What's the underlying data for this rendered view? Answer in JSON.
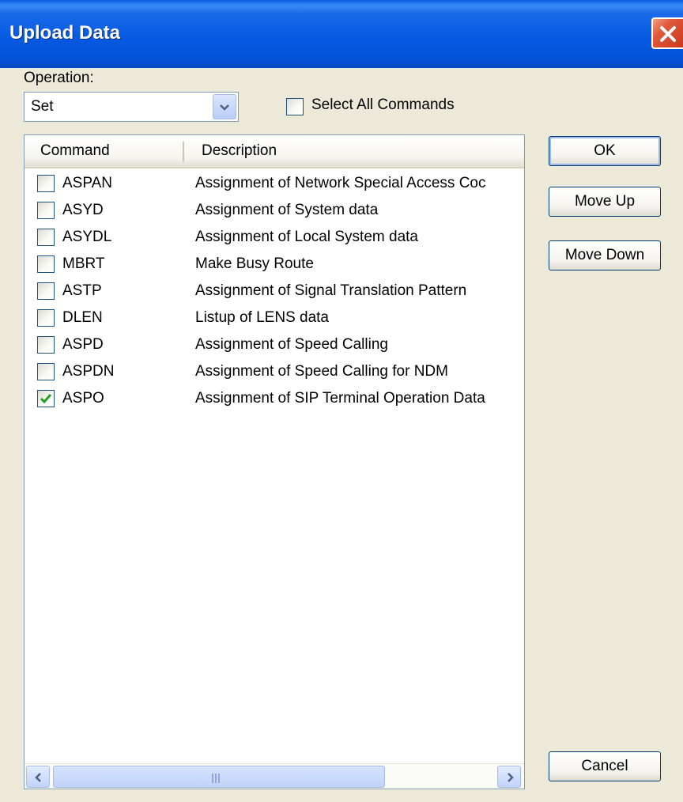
{
  "window": {
    "title": "Upload Data"
  },
  "operation": {
    "label": "Operation:",
    "value": "Set"
  },
  "select_all": {
    "label": "Select All Commands",
    "checked": false
  },
  "columns": {
    "command": "Command",
    "description": "Description"
  },
  "rows": [
    {
      "command": "ASPAN",
      "description": "Assignment of Network Special Access Coc",
      "checked": false
    },
    {
      "command": "ASYD",
      "description": "Assignment of System data",
      "checked": false
    },
    {
      "command": "ASYDL",
      "description": "Assignment of Local System data",
      "checked": false
    },
    {
      "command": "MBRT",
      "description": "Make Busy Route",
      "checked": false
    },
    {
      "command": "ASTP",
      "description": "Assignment of Signal Translation Pattern",
      "checked": false
    },
    {
      "command": "DLEN",
      "description": "Listup of LENS data",
      "checked": false
    },
    {
      "command": "ASPD",
      "description": "Assignment of Speed Calling",
      "checked": false
    },
    {
      "command": "ASPDN",
      "description": "Assignment of Speed Calling for NDM",
      "checked": false
    },
    {
      "command": "ASPO",
      "description": "Assignment of SIP Terminal Operation Data",
      "checked": true
    }
  ],
  "buttons": {
    "ok": "OK",
    "move_up": "Move Up",
    "move_down": "Move Down",
    "cancel": "Cancel"
  },
  "colors": {
    "title_bar": "#0558e0",
    "close_button": "#e0583a",
    "dialog_bg": "#ece9d8",
    "check_mark": "#21a121"
  },
  "icons": {
    "close": "close-icon",
    "dropdown": "chevron-down-icon",
    "scroll_left": "arrow-left-icon",
    "scroll_right": "arrow-right-icon",
    "check": "check-icon"
  }
}
